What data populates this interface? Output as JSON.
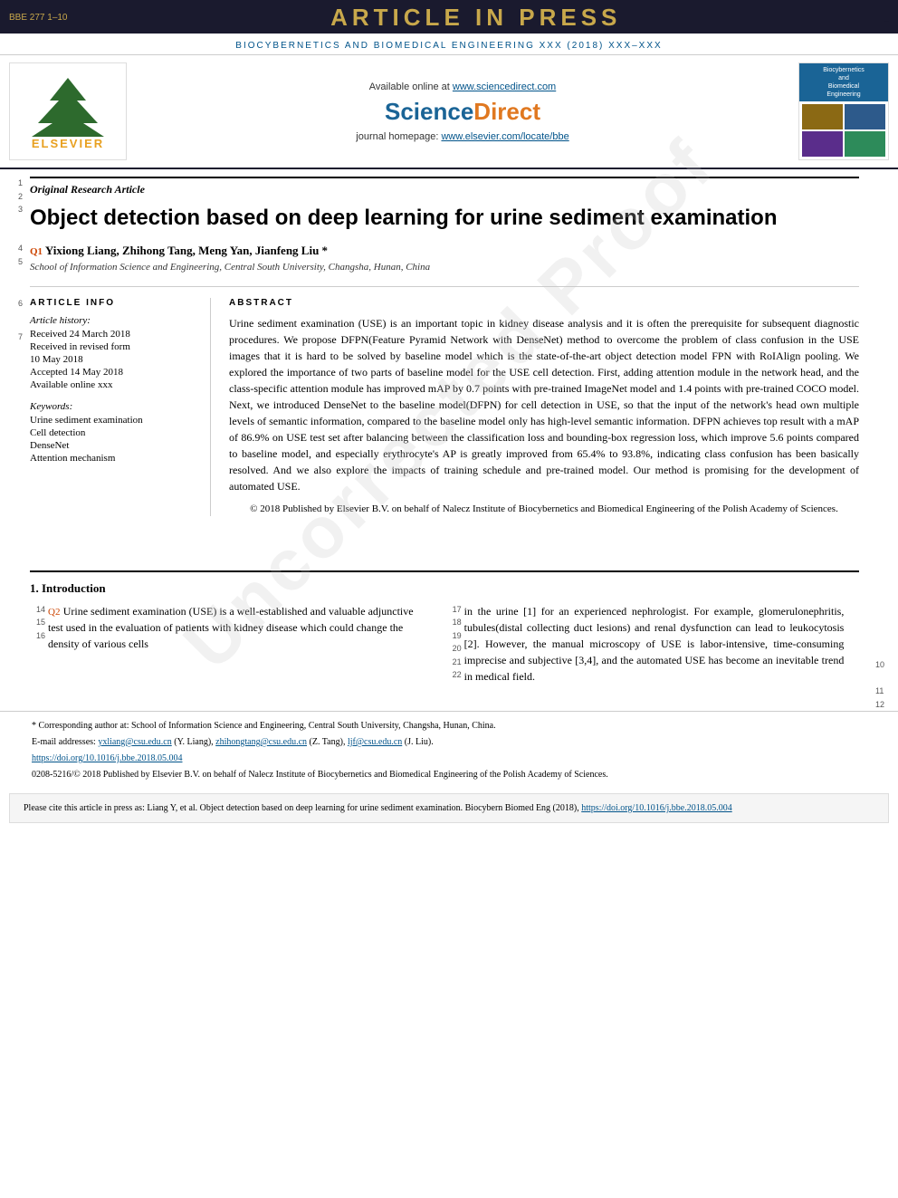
{
  "banner": {
    "ref": "BBE 277 1–10",
    "article_in_press": "ARTICLE IN PRESS",
    "journal_name": "BIOCYBERNETICS AND BIOMEDICAL ENGINEERING XXX (2018) XXX–XXX"
  },
  "header": {
    "available_online": "Available online at",
    "sciencedirect_url": "www.sciencedirect.com",
    "sciencedirect_logo": "ScienceDirect",
    "homepage_label": "journal homepage:",
    "homepage_url": "www.elsevier.com/locate/bbe",
    "cover_title_line1": "Biocybernetics",
    "cover_title_line2": "and",
    "cover_title_line3": "Biomedical",
    "cover_title_line4": "Engineering"
  },
  "article": {
    "type": "Original Research Article",
    "title": "Object detection based on deep learning for urine sediment examination",
    "authors": "Yixiong Liang, Zhihong Tang, Meng Yan, Jianfeng Liu *",
    "affiliation": "School of Information Science and Engineering, Central South University, Changsha, Hunan, China"
  },
  "article_info": {
    "section_label": "ARTICLE INFO",
    "history_label": "Article history:",
    "received1": "Received 24 March 2018",
    "received2": "Received in revised form",
    "received2_date": "10 May 2018",
    "accepted": "Accepted 14 May 2018",
    "available": "Available online xxx",
    "keywords_label": "Keywords:",
    "keyword1": "Urine sediment examination",
    "keyword2": "Cell detection",
    "keyword3": "DenseNet",
    "keyword4": "Attention mechanism"
  },
  "abstract": {
    "section_label": "ABSTRACT",
    "text": "Urine sediment examination (USE) is an important topic in kidney disease analysis and it is often the prerequisite for subsequent diagnostic procedures. We propose DFPN(Feature Pyramid Network with DenseNet) method to overcome the problem of class confusion in the USE images that it is hard to be solved by baseline model which is the state-of-the-art object detection model FPN with RoIAlign pooling. We explored the importance of two parts of baseline model for the USE cell detection. First, adding attention module in the network head, and the class-specific attention module has improved mAP by 0.7 points with pre-trained ImageNet model and 1.4 points with pre-trained COCO model. Next, we introduced DenseNet to the baseline model(DFPN) for cell detection in USE, so that the input of the network's head own multiple levels of semantic information, compared to the baseline model only has high-level semantic information. DFPN achieves top result with a mAP of 86.9% on USE test set after balancing between the classification loss and bounding-box regression loss, which improve 5.6 points compared to baseline model, and especially erythrocyte's AP is greatly improved from 65.4% to 93.8%, indicating class confusion has been basically resolved. And we also explore the impacts of training schedule and pre-trained model. Our method is promising for the development of automated USE.",
    "copyright": "© 2018 Published by Elsevier B.V. on behalf of Nalecz Institute of Biocybernetics and Biomedical Engineering of the Polish Academy of Sciences."
  },
  "intro": {
    "section_num": "1.",
    "section_title": "Introduction",
    "line_numbers": {
      "left_start": 14,
      "right_start": 17
    },
    "left_text": "Urine sediment examination (USE) is a well-established and valuable adjunctive test used in the evaluation of patients with kidney disease which could change the density of various cells",
    "right_text": "in the urine [1] for an experienced nephrologist. For example, glomerulonephritis, tubules(distal collecting duct lesions) and renal dysfunction can lead to leukocytosis [2]. However, the manual microscopy of USE is labor-intensive, time-consuming imprecise and subjective [3,4], and the automated USE has become an inevitable trend in medical field."
  },
  "footer": {
    "corresponding_note": "* Corresponding author at: School of Information Science and Engineering, Central South University, Changsha, Hunan, China.",
    "email_label": "E-mail addresses:",
    "email1": "yxliang@csu.edu.cn",
    "email1_name": "(Y. Liang),",
    "email2": "zhihongtang@csu.edu.cn",
    "email2_name": "(Z. Tang),",
    "email3": "ljf@csu.edu.cn",
    "email3_name": "(J. Liu).",
    "doi": "https://doi.org/10.1016/j.bbe.2018.05.004",
    "issn": "0208-5216/© 2018 Published by Elsevier B.V. on behalf of Nalecz Institute of Biocybernetics and Biomedical Engineering of the Polish Academy of Sciences."
  },
  "citation": {
    "text": "Please cite this article in press as: Liang Y, et al. Object detection based on deep learning for urine sediment examination. Biocybern Biomed Eng (2018),",
    "doi_link": "https://doi.org/10.1016/j.bbe.2018.05.004"
  },
  "line_numbers_left": [
    "1",
    "2",
    "3",
    "",
    "",
    "",
    "4",
    "5",
    "",
    "",
    "6",
    "",
    "7",
    "",
    "",
    "",
    "",
    "",
    "",
    "",
    "",
    "",
    "",
    "",
    "",
    "",
    "",
    "",
    "",
    "",
    "",
    "",
    "",
    "",
    "",
    "",
    "",
    "",
    "",
    "",
    "",
    "",
    "",
    "",
    "",
    "",
    "",
    "",
    "",
    "",
    "",
    "",
    "",
    "",
    "",
    "",
    "",
    "",
    "",
    "",
    "",
    "",
    "",
    "",
    "",
    "",
    "",
    "",
    "",
    "",
    "",
    "",
    "",
    "",
    "",
    "",
    "",
    "",
    "",
    "",
    "",
    "",
    "",
    "",
    "",
    "",
    "",
    "",
    "",
    "",
    "",
    "",
    "",
    "",
    "",
    "",
    "",
    "",
    "10",
    "",
    "11",
    "12"
  ],
  "line_numbers_right_intro": [
    "17",
    "18",
    "19",
    "20",
    "21",
    "22"
  ]
}
